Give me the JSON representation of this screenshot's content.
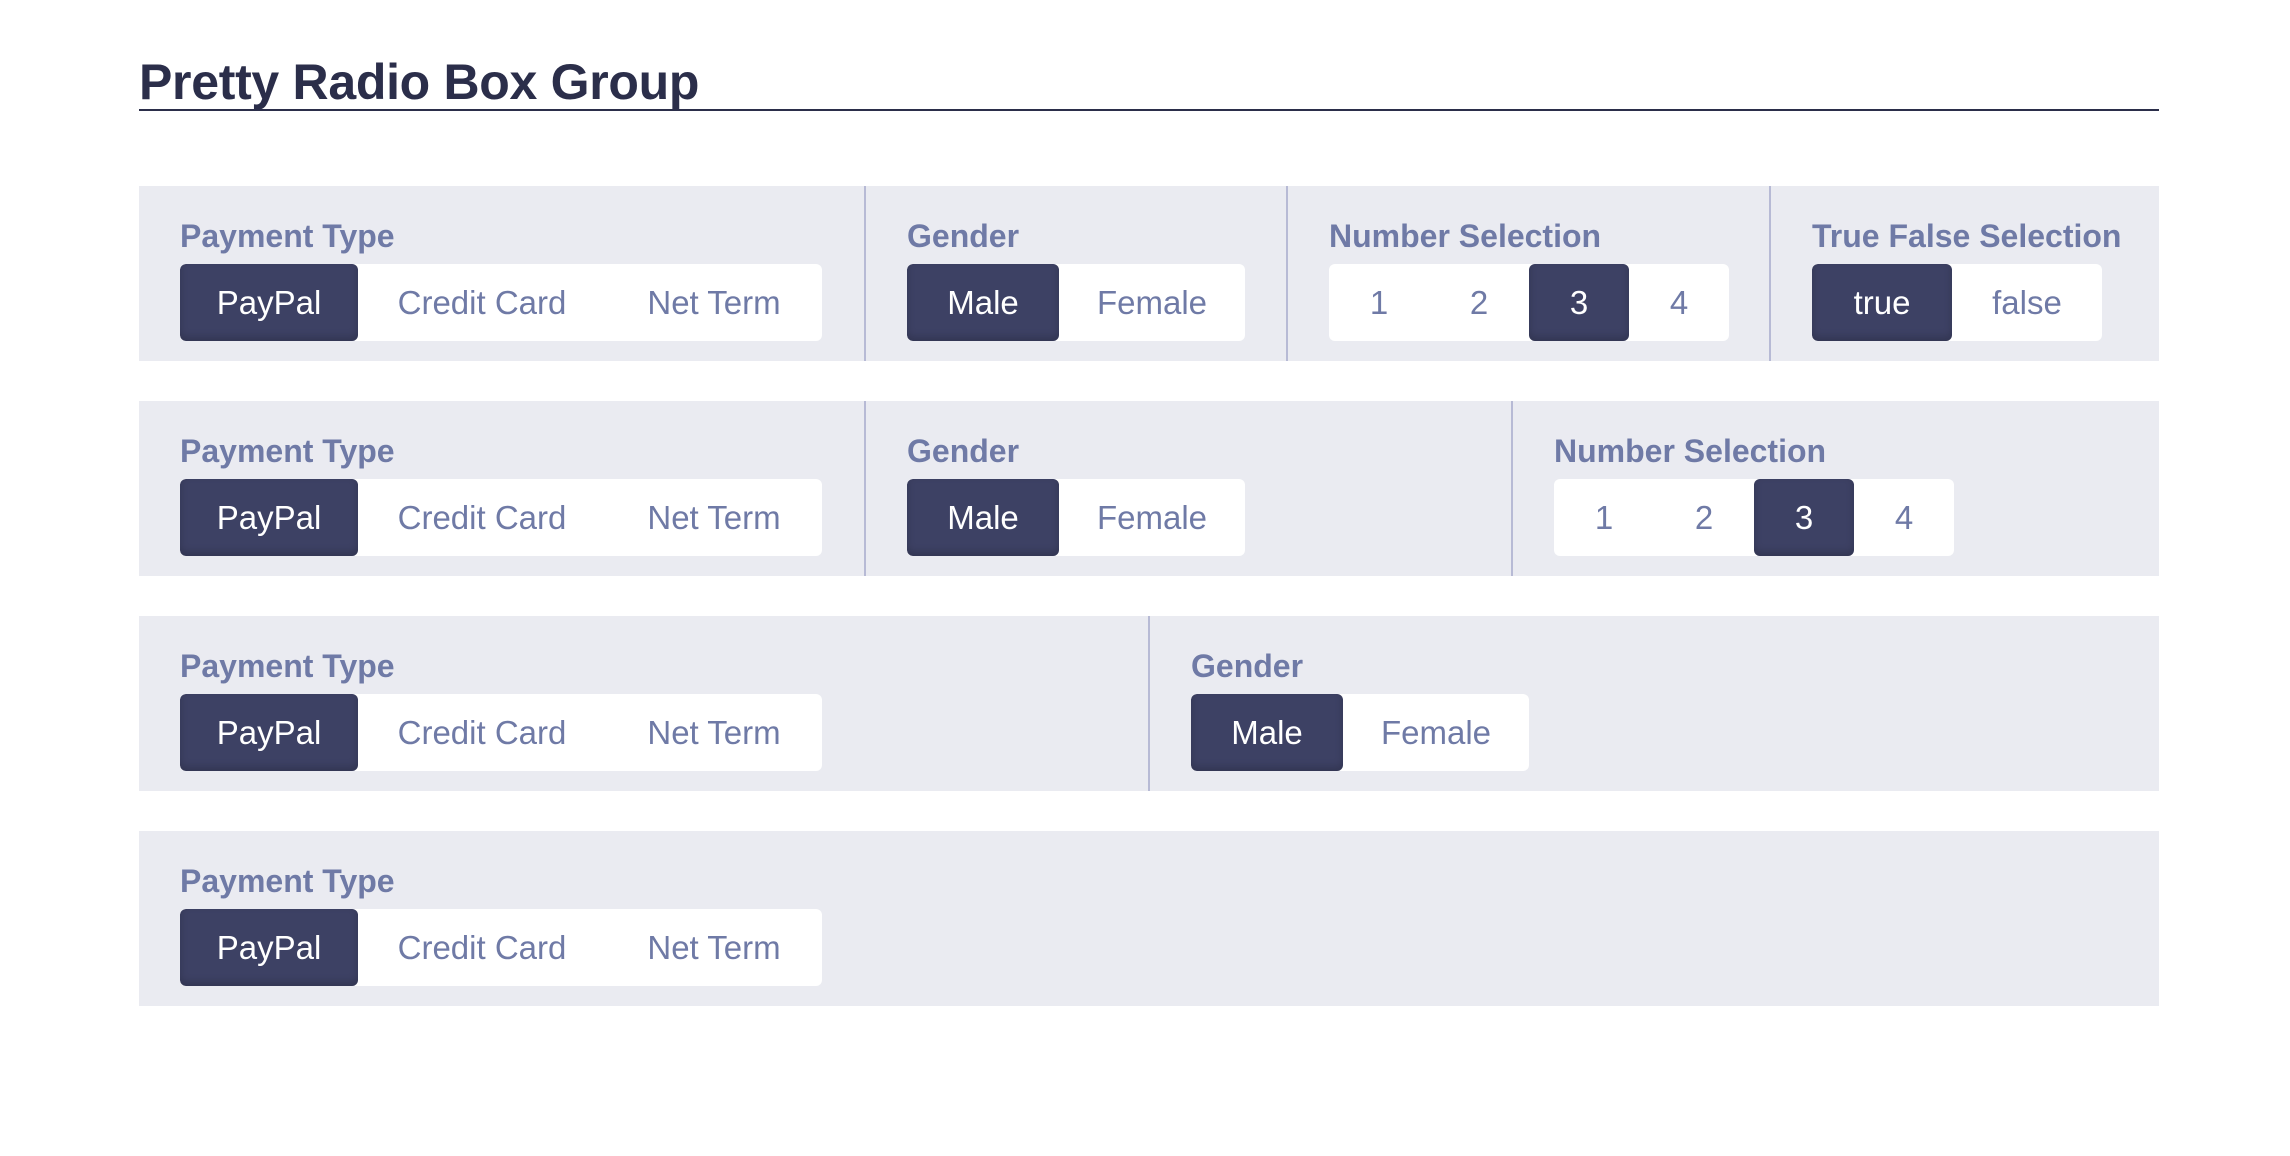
{
  "page": {
    "title": "Pretty Radio Box Group"
  },
  "colors": {
    "heading": "#2b2e4a",
    "panel_bg": "#eaebf1",
    "label": "#6f7aa6",
    "selected_bg": "#3d4164",
    "option_bg": "#ffffff",
    "divider": "#b7bad5"
  },
  "rows": [
    {
      "groups": [
        {
          "label": "Payment Type",
          "options": [
            "PayPal",
            "Credit Card",
            "Net Term"
          ],
          "selected": "PayPal"
        },
        {
          "label": "Gender",
          "options": [
            "Male",
            "Female"
          ],
          "selected": "Male"
        },
        {
          "label": "Number Selection",
          "options": [
            "1",
            "2",
            "3",
            "4"
          ],
          "selected": "3"
        },
        {
          "label": "True False Selection",
          "options": [
            "true",
            "false"
          ],
          "selected": "true"
        }
      ]
    },
    {
      "groups": [
        {
          "label": "Payment Type",
          "options": [
            "PayPal",
            "Credit Card",
            "Net Term"
          ],
          "selected": "PayPal"
        },
        {
          "label": "Gender",
          "options": [
            "Male",
            "Female"
          ],
          "selected": "Male"
        },
        {
          "label": "Number Selection",
          "options": [
            "1",
            "2",
            "3",
            "4"
          ],
          "selected": "3"
        }
      ]
    },
    {
      "groups": [
        {
          "label": "Payment Type",
          "options": [
            "PayPal",
            "Credit Card",
            "Net Term"
          ],
          "selected": "PayPal"
        },
        {
          "label": "Gender",
          "options": [
            "Male",
            "Female"
          ],
          "selected": "Male"
        }
      ]
    },
    {
      "groups": [
        {
          "label": "Payment Type",
          "options": [
            "PayPal",
            "Credit Card",
            "Net Term"
          ],
          "selected": "PayPal"
        }
      ]
    }
  ]
}
